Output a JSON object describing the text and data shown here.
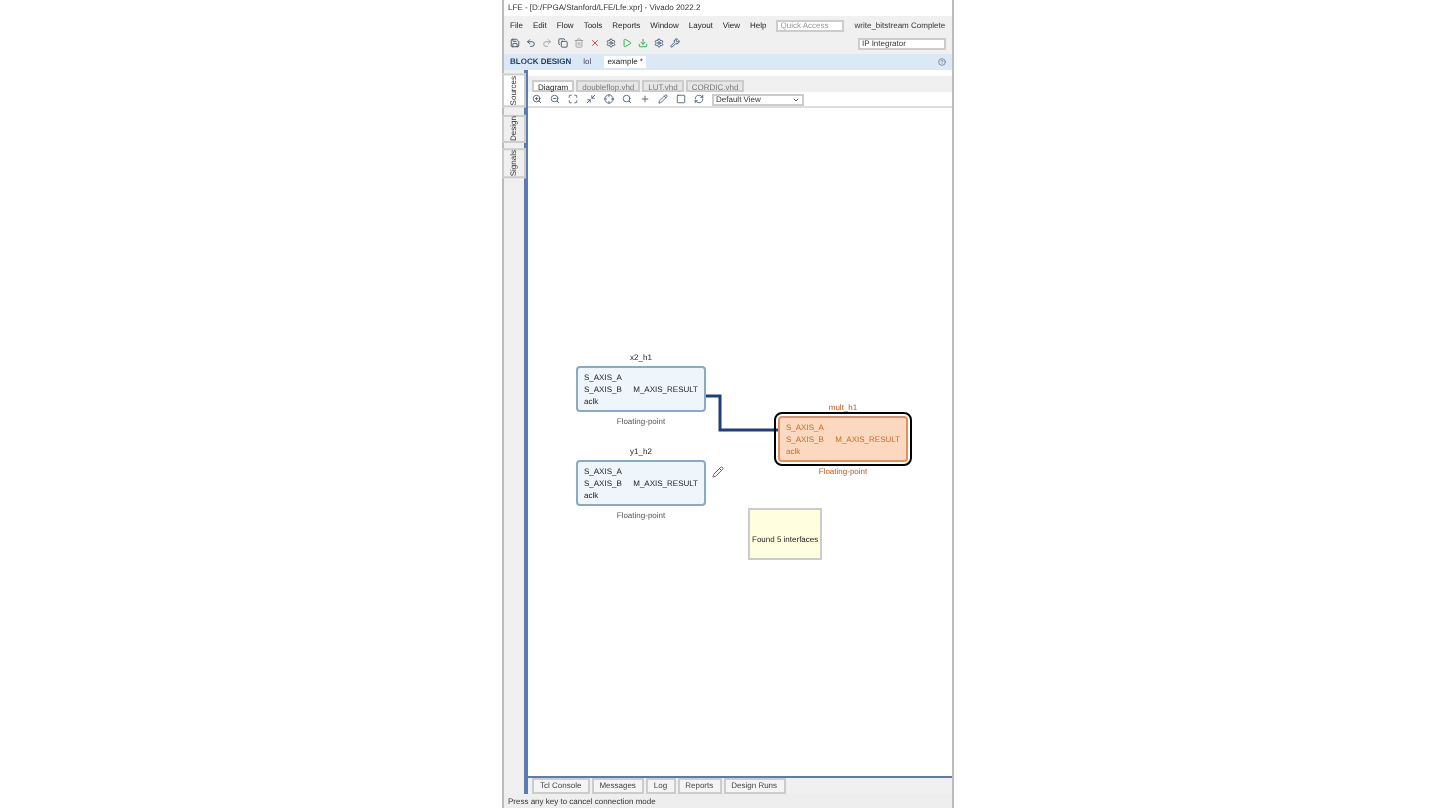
{
  "window": {
    "title": "LFE - [D:/FPGA/Stanford/LFE/Lfe.xpr] - Vivado 2022.2"
  },
  "menu": [
    "File",
    "Edit",
    "Flow",
    "Tools",
    "Reports",
    "Window",
    "Layout",
    "View",
    "Help"
  ],
  "quick_access": {
    "placeholder": "Quick Access"
  },
  "run_status": "write_bitstream Complete",
  "layout_select": "IP Integrator",
  "design_bar": {
    "title": "BLOCK DESIGN",
    "tabs": [
      {
        "label": "lol",
        "selected": false
      },
      {
        "label": "example *",
        "selected": true
      }
    ]
  },
  "side_tabs": [
    {
      "label": "Sources",
      "selected": true
    },
    {
      "label": "Design",
      "selected": false
    },
    {
      "label": "Signals",
      "selected": false
    }
  ],
  "editor_tabs": [
    {
      "label": "Diagram",
      "selected": true
    },
    {
      "label": "doubleflop.vhd",
      "selected": false
    },
    {
      "label": "LUT.vhd",
      "selected": false
    },
    {
      "label": "CORDIC.vhd",
      "selected": false
    }
  ],
  "view_select": "Default View",
  "blocks": [
    {
      "name": "x2_h1",
      "type": "Floating-point",
      "selected": false,
      "inputs": [
        "S_AXIS_A",
        "S_AXIS_B"
      ],
      "output": "M_AXIS_RESULT",
      "clock": "aclk"
    },
    {
      "name": "y1_h2",
      "type": "Floating-point",
      "selected": false,
      "inputs": [
        "S_AXIS_A",
        "S_AXIS_B"
      ],
      "output": "M_AXIS_RESULT",
      "clock": "aclk"
    },
    {
      "name": "mult_h1",
      "type": "Floating-point",
      "selected": true,
      "inputs": [
        "S_AXIS_A",
        "S_AXIS_B"
      ],
      "output": "M_AXIS_RESULT",
      "clock": "aclk"
    }
  ],
  "tooltip": "Found 5 interfaces",
  "bottom_tabs": [
    {
      "label": "Tcl Console",
      "selected": false
    },
    {
      "label": "Messages",
      "selected": false
    },
    {
      "label": "Log",
      "selected": false
    },
    {
      "label": "Reports",
      "selected": false
    },
    {
      "label": "Design Runs",
      "selected": false
    }
  ],
  "status_bar": "Press any key to cancel connection mode"
}
